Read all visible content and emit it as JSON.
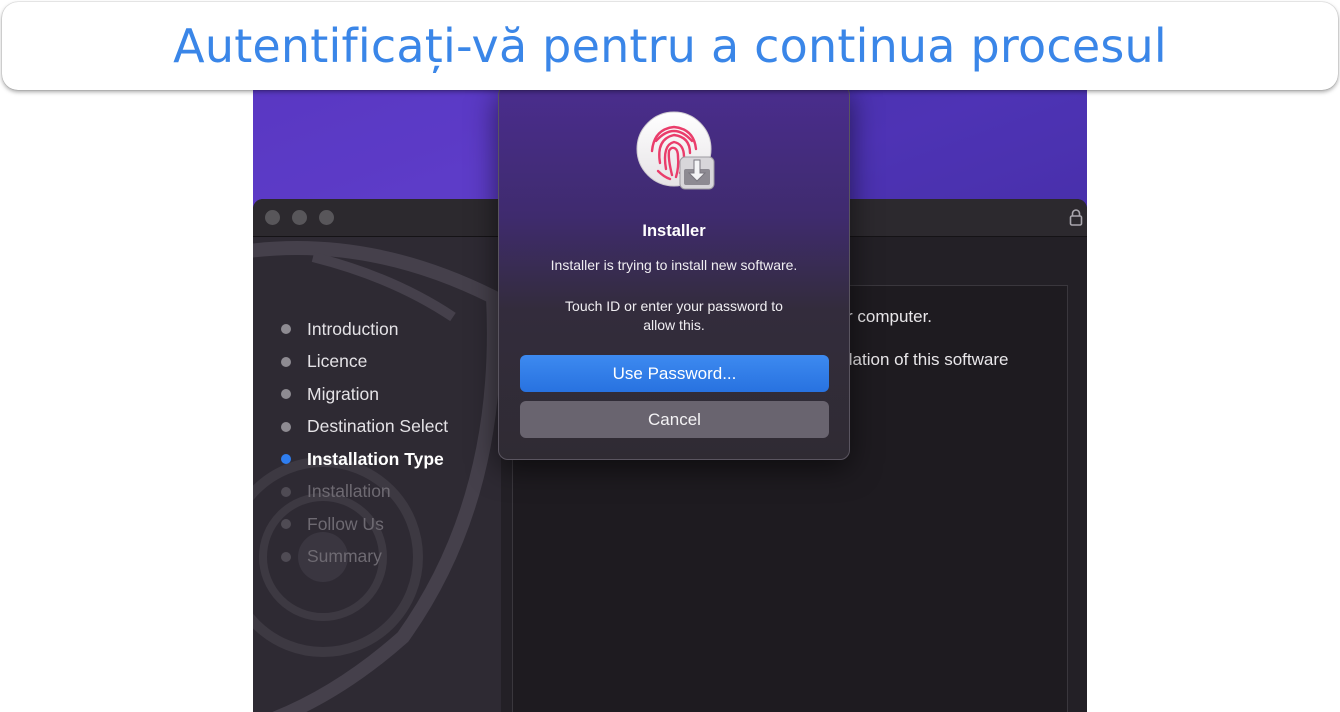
{
  "banner": {
    "title": "Autentificați-vă pentru a continua procesul"
  },
  "installer": {
    "steps": [
      {
        "label": "Introduction",
        "state": "done"
      },
      {
        "label": "Licence",
        "state": "done"
      },
      {
        "label": "Migration",
        "state": "done"
      },
      {
        "label": "Destination Select",
        "state": "done"
      },
      {
        "label": "Installation Type",
        "state": "active"
      },
      {
        "label": "Installation",
        "state": "pending"
      },
      {
        "label": "Follow Us",
        "state": "pending"
      },
      {
        "label": "Summary",
        "state": "pending"
      }
    ],
    "content_line1": "r computer.",
    "content_line2": "llation of this software"
  },
  "dialog": {
    "title": "Installer",
    "message": "Installer is trying to install new software.",
    "prompt_line1": "Touch ID or enter your password to",
    "prompt_line2": "allow this.",
    "primary_button": "Use Password...",
    "secondary_button": "Cancel",
    "icon": "fingerprint-installer-icon"
  },
  "colors": {
    "banner_text": "#3a86e8",
    "accent": "#2f7ef0",
    "desktop": "#5130b8"
  }
}
